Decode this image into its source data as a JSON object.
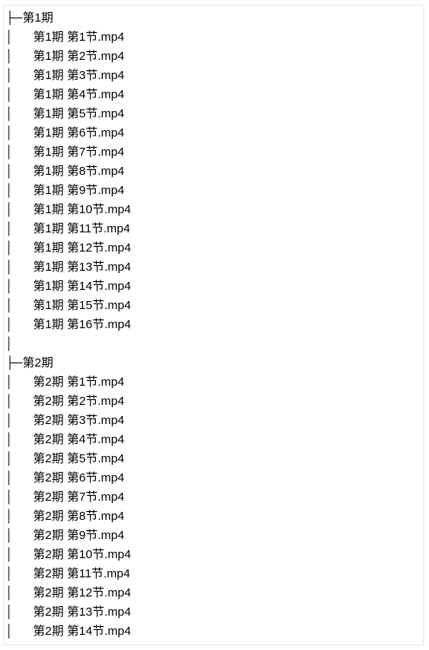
{
  "tree": {
    "folders": [
      {
        "prefix": "├─",
        "name": "第1期",
        "files": [
          {
            "prefix": "│      ",
            "name": "第1期 第1节.mp4"
          },
          {
            "prefix": "│      ",
            "name": "第1期 第2节.mp4"
          },
          {
            "prefix": "│      ",
            "name": "第1期 第3节.mp4"
          },
          {
            "prefix": "│      ",
            "name": "第1期 第4节.mp4"
          },
          {
            "prefix": "│      ",
            "name": "第1期 第5节.mp4"
          },
          {
            "prefix": "│      ",
            "name": "第1期 第6节.mp4"
          },
          {
            "prefix": "│      ",
            "name": "第1期 第7节.mp4"
          },
          {
            "prefix": "│      ",
            "name": "第1期 第8节.mp4"
          },
          {
            "prefix": "│      ",
            "name": "第1期 第9节.mp4"
          },
          {
            "prefix": "│      ",
            "name": "第1期 第10节.mp4"
          },
          {
            "prefix": "│      ",
            "name": "第1期 第11节.mp4"
          },
          {
            "prefix": "│      ",
            "name": "第1期 第12节.mp4"
          },
          {
            "prefix": "│      ",
            "name": "第1期 第13节.mp4"
          },
          {
            "prefix": "│      ",
            "name": "第1期 第14节.mp4"
          },
          {
            "prefix": "│      ",
            "name": "第1期 第15节.mp4"
          },
          {
            "prefix": "│      ",
            "name": "第1期 第16节.mp4"
          }
        ],
        "trailing": "│      "
      },
      {
        "prefix": "├─",
        "name": "第2期",
        "files": [
          {
            "prefix": "│      ",
            "name": "第2期 第1节.mp4"
          },
          {
            "prefix": "│      ",
            "name": "第2期 第2节.mp4"
          },
          {
            "prefix": "│      ",
            "name": "第2期 第3节.mp4"
          },
          {
            "prefix": "│      ",
            "name": "第2期 第4节.mp4"
          },
          {
            "prefix": "│      ",
            "name": "第2期 第5节.mp4"
          },
          {
            "prefix": "│      ",
            "name": "第2期 第6节.mp4"
          },
          {
            "prefix": "│      ",
            "name": "第2期 第7节.mp4"
          },
          {
            "prefix": "│      ",
            "name": "第2期 第8节.mp4"
          },
          {
            "prefix": "│      ",
            "name": "第2期 第9节.mp4"
          },
          {
            "prefix": "│      ",
            "name": "第2期 第10节.mp4"
          },
          {
            "prefix": "│      ",
            "name": "第2期 第11节.mp4"
          },
          {
            "prefix": "│      ",
            "name": "第2期 第12节.mp4"
          },
          {
            "prefix": "│      ",
            "name": "第2期 第13节.mp4"
          },
          {
            "prefix": "│      ",
            "name": "第2期 第14节.mp4"
          }
        ],
        "trailing": null
      }
    ]
  }
}
